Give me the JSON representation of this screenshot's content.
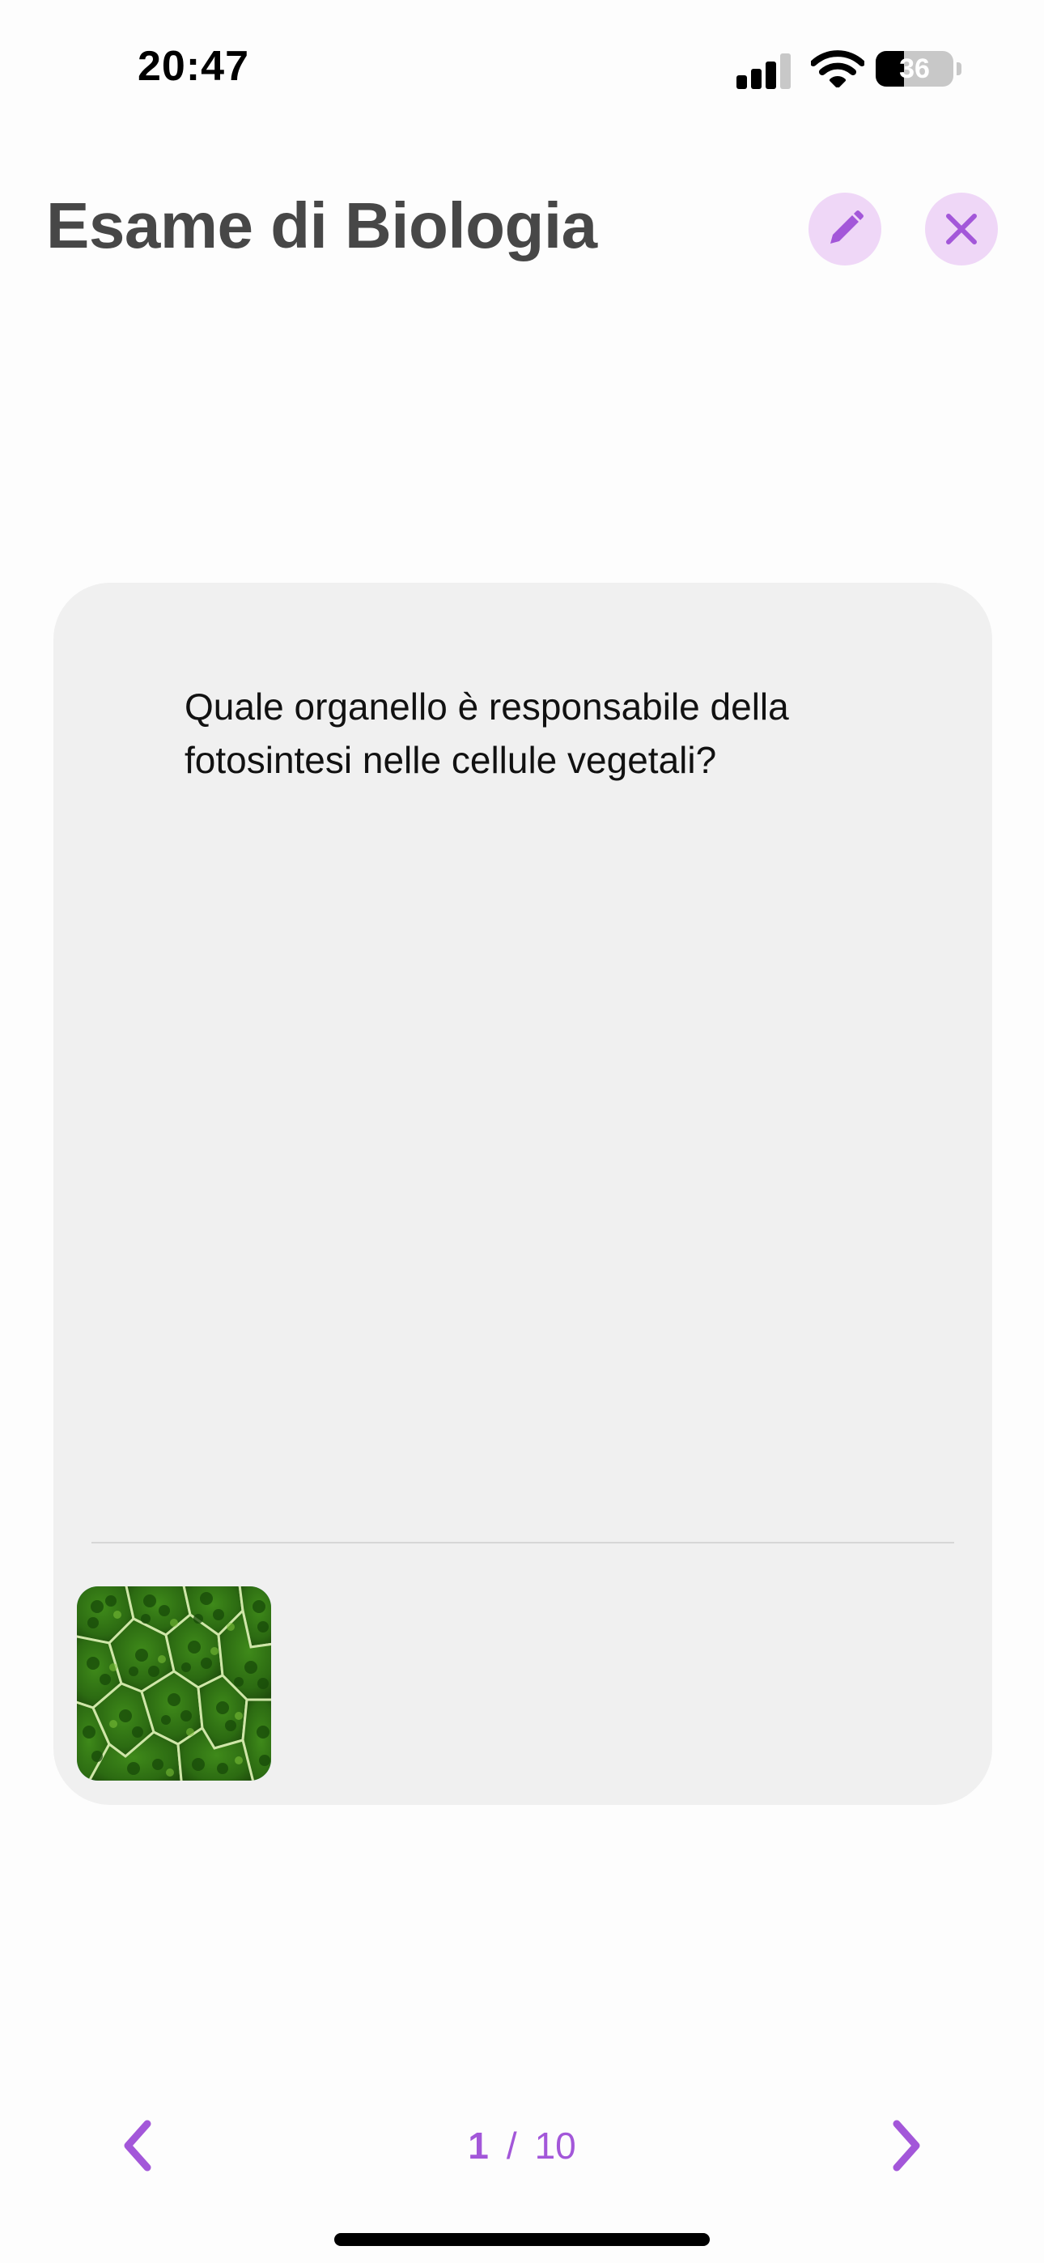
{
  "status_bar": {
    "time": "20:47",
    "battery_level": "36",
    "battery_fraction": 0.36,
    "icons": [
      "cellular-signal-icon",
      "wifi-icon",
      "battery-icon"
    ]
  },
  "header": {
    "title": "Esame di Biologia",
    "edit_icon": "pencil-icon",
    "close_icon": "close-icon"
  },
  "card": {
    "question": "Quale organello è responsabile della fotosintesi nelle cellule vegetali?",
    "attachment": "plant-cell-microscope-image"
  },
  "pagination": {
    "current": "1",
    "separator": "/",
    "total": "10",
    "prev_icon": "chevron-left-icon",
    "next_icon": "chevron-right-icon"
  },
  "colors": {
    "accent": "#a357d9",
    "accent_light": "#efd7f7",
    "card_background": "#f0f0f0",
    "title": "#474747"
  }
}
